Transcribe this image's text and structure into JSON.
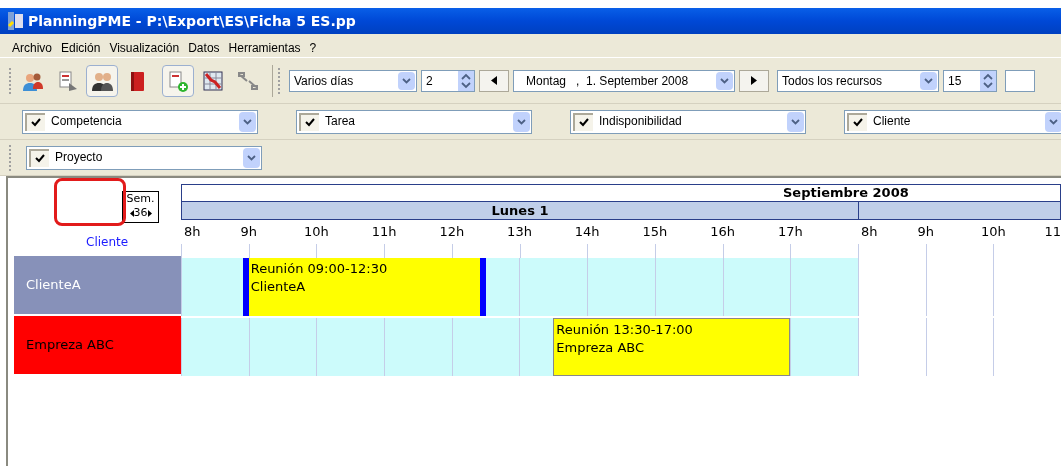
{
  "window": {
    "title": "PlanningPME - P:\\Export\\ES\\Ficha 5 ES.pp"
  },
  "menu": [
    "Archivo",
    "Edición",
    "Visualización",
    "Datos",
    "Herramientas",
    "?"
  ],
  "toolbar_buttons": [
    {
      "kind": "people",
      "pressed": false
    },
    {
      "kind": "report",
      "pressed": false
    },
    {
      "kind": "group",
      "pressed": true
    },
    {
      "kind": "book",
      "pressed": false
    },
    {
      "kind": "add-task",
      "pressed": true
    },
    {
      "kind": "chart",
      "pressed": false
    },
    {
      "kind": "link",
      "pressed": false
    }
  ],
  "view_mode": "Varios días",
  "days": "2",
  "date": "Montag   ,  1. September 2008",
  "resources_filter": "Todos los recursos",
  "zoom": "15",
  "filters": [
    [
      {
        "label": "Competencia",
        "checked": true
      },
      {
        "label": "Tarea",
        "checked": true
      },
      {
        "label": "Indisponibilidad",
        "checked": true
      },
      {
        "label": "Cliente",
        "checked": true
      }
    ],
    [
      {
        "label": "Proyecto",
        "checked": true
      }
    ]
  ],
  "planner": {
    "week": {
      "label": "Sem.",
      "number": "36"
    },
    "resource_header": "Cliente",
    "month": "Septiembre 2008",
    "days": [
      {
        "label": "Lunes 1",
        "hours": [
          "8h",
          "9h",
          "10h",
          "11h",
          "12h",
          "13h",
          "14h",
          "15h",
          "16h",
          "17h"
        ]
      },
      {
        "hours": [
          "8h",
          "9h",
          "10h",
          "11"
        ]
      }
    ],
    "resources": [
      {
        "name": "ClienteA",
        "color": "#8791b9",
        "events": [
          {
            "title": "Reunión 09:00-12:30",
            "subtitle": "ClienteA",
            "selected": true
          }
        ]
      },
      {
        "name": "Empreza ABC",
        "color": "#ff0000",
        "events": [
          {
            "title": "Reunión 13:30-17:00",
            "subtitle": "Empreza ABC",
            "selected": false
          }
        ]
      }
    ]
  }
}
